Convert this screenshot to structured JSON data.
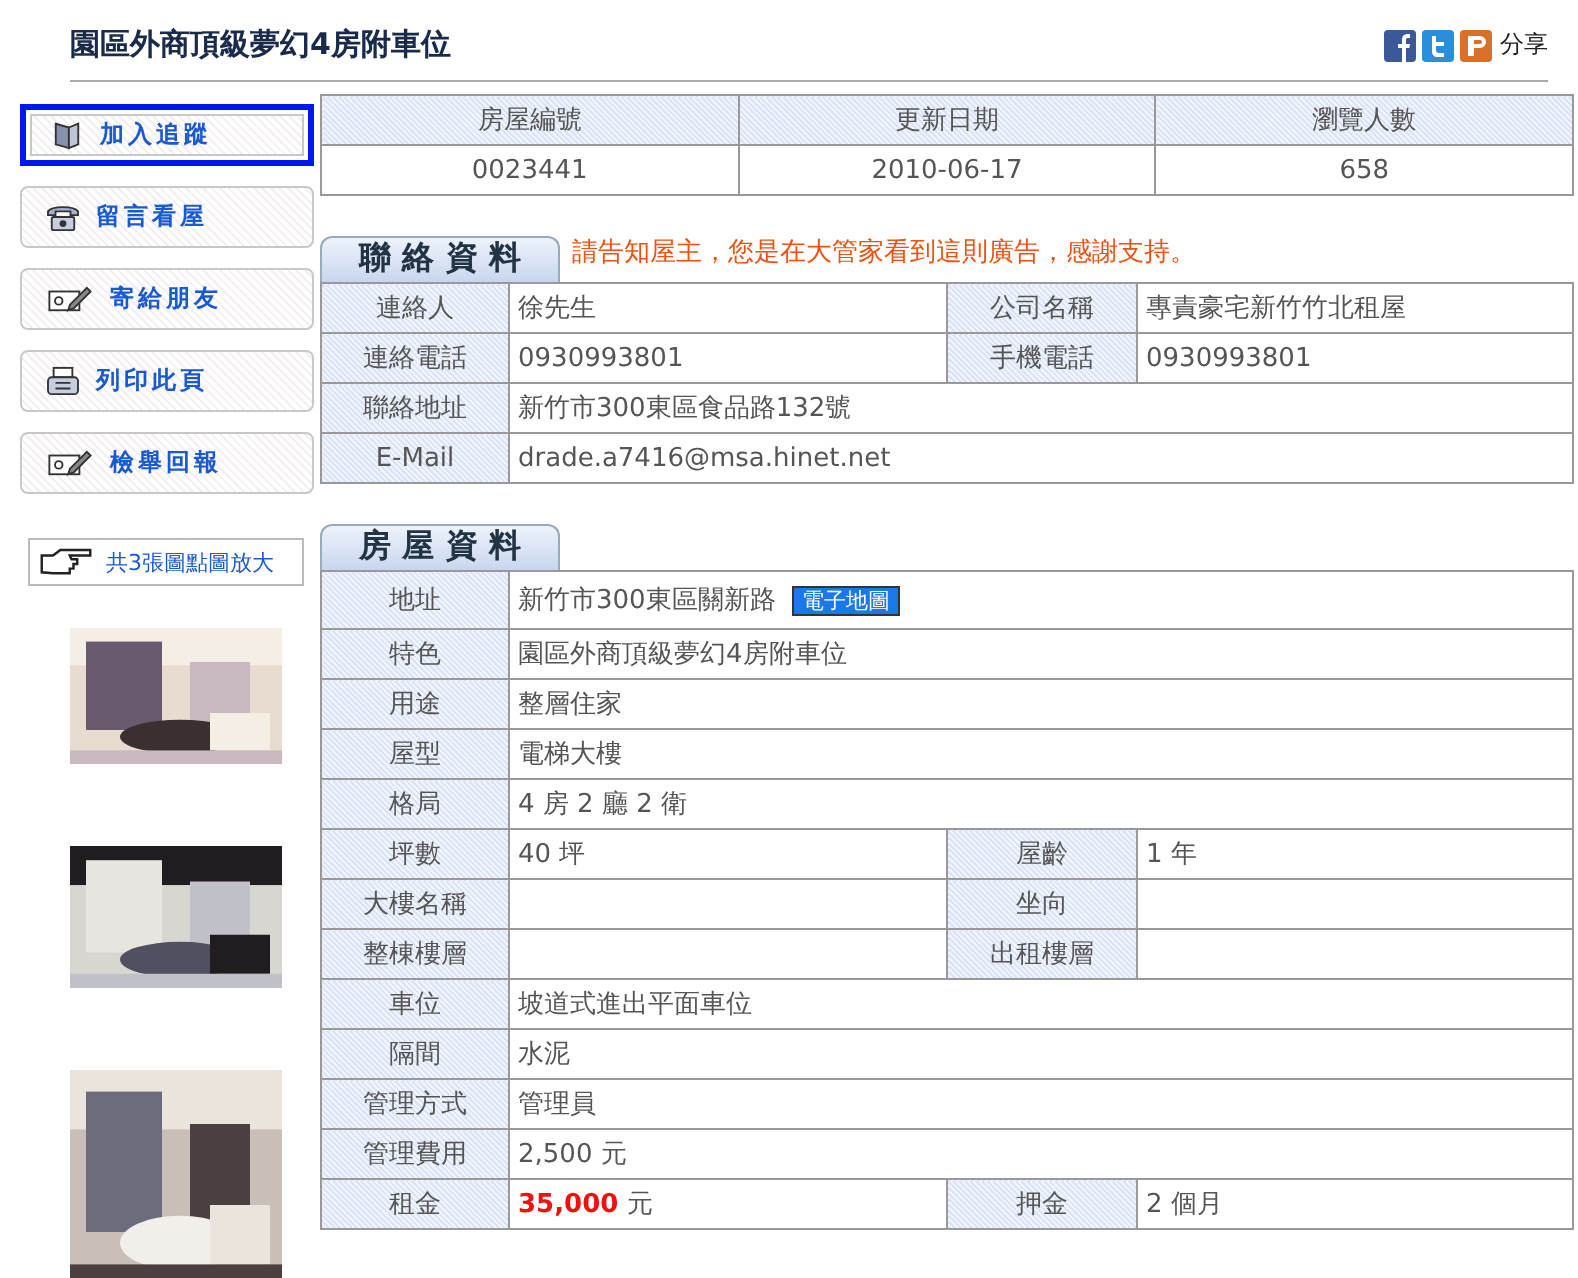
{
  "title": "園區外商頂級夢幻4房附車位",
  "share": {
    "label": "分享"
  },
  "actions": [
    {
      "label": "加入追蹤",
      "kind": "book",
      "selected": true
    },
    {
      "label": "留言看屋",
      "kind": "phone",
      "selected": false
    },
    {
      "label": "寄給朋友",
      "kind": "card",
      "selected": false
    },
    {
      "label": "列印此頁",
      "kind": "printer",
      "selected": false
    },
    {
      "label": "檢舉回報",
      "kind": "card",
      "selected": false
    }
  ],
  "photo_hint": "共3張圖點圖放大",
  "summary": {
    "columns": [
      "房屋編號",
      "更新日期",
      "瀏覽人數"
    ],
    "values": [
      "0023441",
      "2010-06-17",
      "658"
    ]
  },
  "contact": {
    "title": "聯 絡 資 料",
    "notice": "請告知屋主，您是在大管家看到這則廣告，感謝支持。",
    "rows": [
      [
        {
          "label": "連絡人",
          "value": "徐先生"
        },
        {
          "label": "公司名稱",
          "value": "專責豪宅新竹竹北租屋"
        }
      ],
      [
        {
          "label": "連絡電話",
          "value": "0930993801"
        },
        {
          "label": "手機電話",
          "value": "0930993801"
        }
      ],
      [
        {
          "label": "聯絡地址",
          "value": "新竹市300東區食品路132號"
        }
      ],
      [
        {
          "label": "E-Mail",
          "value": "drade.a7416@msa.hinet.net"
        }
      ]
    ]
  },
  "house": {
    "title": "房 屋 資 料",
    "rows": [
      [
        {
          "label": "地址",
          "value": "新竹市300東區關新路",
          "link": "電子地圖"
        }
      ],
      [
        {
          "label": "特色",
          "value": "園區外商頂級夢幻4房附車位"
        }
      ],
      [
        {
          "label": "用途",
          "value": "整層住家"
        }
      ],
      [
        {
          "label": "屋型",
          "value": "電梯大樓"
        }
      ],
      [
        {
          "label": "格局",
          "value": "4 房 2 廳 2 衛"
        }
      ],
      [
        {
          "label": "坪數",
          "value": "40 坪"
        },
        {
          "label": "屋齡",
          "value": "1 年"
        }
      ],
      [
        {
          "label": "大樓名稱"
        },
        {
          "label": "坐向"
        }
      ],
      [
        {
          "label": "整棟樓層"
        },
        {
          "label": "出租樓層"
        }
      ],
      [
        {
          "label": "車位",
          "value": "坡道式進出平面車位"
        }
      ],
      [
        {
          "label": "隔間",
          "value": "水泥"
        }
      ],
      [
        {
          "label": "管理方式",
          "value": "管理員"
        }
      ],
      [
        {
          "label": "管理費用",
          "value": "2,500 元"
        }
      ],
      [
        {
          "label": "租金",
          "value": "**35,000** 元"
        },
        {
          "label": "押金",
          "value": "2 個月"
        }
      ]
    ]
  }
}
